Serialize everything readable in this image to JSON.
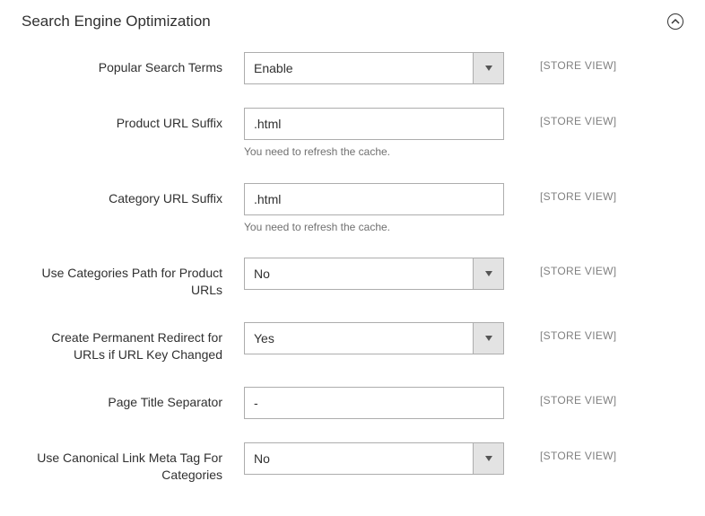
{
  "section": {
    "title": "Search Engine Optimization"
  },
  "fields": {
    "popular_search_terms": {
      "label": "Popular Search Terms",
      "value": "Enable",
      "scope": "[STORE VIEW]"
    },
    "product_url_suffix": {
      "label": "Product URL Suffix",
      "value": ".html",
      "note": "You need to refresh the cache.",
      "scope": "[STORE VIEW]"
    },
    "category_url_suffix": {
      "label": "Category URL Suffix",
      "value": ".html",
      "note": "You need to refresh the cache.",
      "scope": "[STORE VIEW]"
    },
    "use_categories_path": {
      "label": "Use Categories Path for Product URLs",
      "value": "No",
      "scope": "[STORE VIEW]"
    },
    "create_permanent_redirect": {
      "label": "Create Permanent Redirect for URLs if URL Key Changed",
      "value": "Yes",
      "scope": "[STORE VIEW]"
    },
    "page_title_separator": {
      "label": "Page Title Separator",
      "value": "-",
      "scope": "[STORE VIEW]"
    },
    "use_canonical_categories": {
      "label": "Use Canonical Link Meta Tag For Categories",
      "value": "No",
      "scope": "[STORE VIEW]"
    }
  }
}
